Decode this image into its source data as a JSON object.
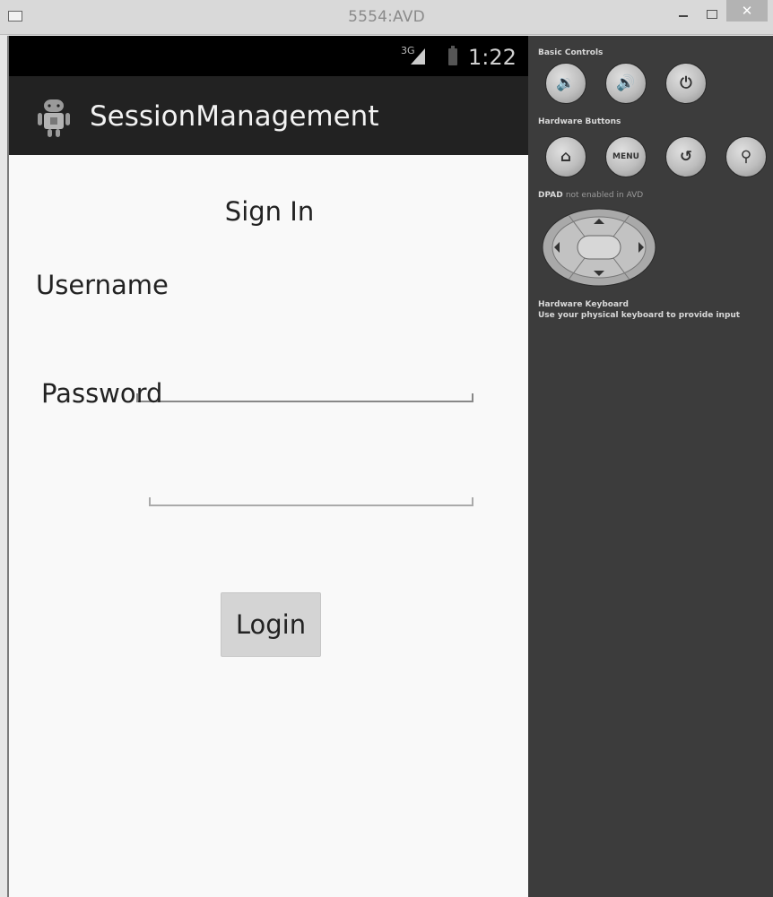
{
  "window": {
    "title": "5554:AVD",
    "close_label": "✕"
  },
  "status_bar": {
    "network": "3G",
    "time": "1:22"
  },
  "action_bar": {
    "app_title": "SessionManagement",
    "icon": "android-robot-icon"
  },
  "form": {
    "heading": "Sign In",
    "username_label": "Username",
    "username_value": "",
    "password_label": "Password",
    "password_value": "",
    "login_label": "Login"
  },
  "panel": {
    "basic_controls_title": "Basic Controls",
    "basic_controls": [
      {
        "name": "volume-down-icon",
        "glyph": "🔉"
      },
      {
        "name": "volume-up-icon",
        "glyph": "🔊"
      },
      {
        "name": "power-icon",
        "glyph": "⏻"
      }
    ],
    "hardware_buttons_title": "Hardware Buttons",
    "hardware_buttons": [
      {
        "name": "home-icon",
        "glyph": "⌂"
      },
      {
        "name": "menu-button",
        "glyph": "MENU"
      },
      {
        "name": "back-icon",
        "glyph": "↺"
      },
      {
        "name": "search-icon",
        "glyph": "⚲"
      }
    ],
    "dpad_title": "DPAD",
    "dpad_note": "not enabled in AVD",
    "keyboard_title": "Hardware Keyboard",
    "keyboard_note": "Use your physical keyboard to provide input"
  },
  "colors": {
    "title_bar": "#d9d9d9",
    "status_bar": "#000000",
    "action_bar": "#222222",
    "content_bg": "#f9f9f9",
    "panel_bg": "#3c3c3c",
    "button_bg": "#d4d4d4"
  }
}
